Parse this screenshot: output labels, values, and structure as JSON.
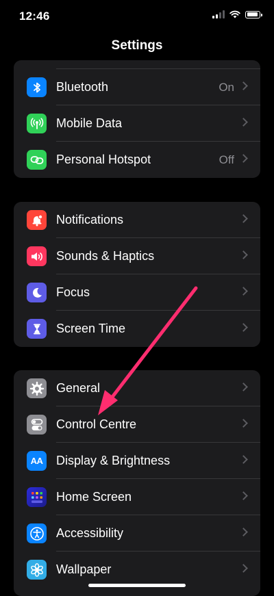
{
  "status": {
    "time": "12:46"
  },
  "nav": {
    "title": "Settings"
  },
  "groups": [
    {
      "rows": [
        {
          "label": "Bluetooth",
          "value": "On",
          "icon": "bluetooth-icon",
          "color": "#0a84ff"
        },
        {
          "label": "Mobile Data",
          "value": "",
          "icon": "antenna-icon",
          "color": "#30d158"
        },
        {
          "label": "Personal Hotspot",
          "value": "Off",
          "icon": "hotspot-link-icon",
          "color": "#30d158"
        }
      ]
    },
    {
      "rows": [
        {
          "label": "Notifications",
          "value": "",
          "icon": "bell-icon",
          "color": "#ff453a"
        },
        {
          "label": "Sounds & Haptics",
          "value": "",
          "icon": "speaker-icon",
          "color": "#ff375f"
        },
        {
          "label": "Focus",
          "value": "",
          "icon": "moon-icon",
          "color": "#5e5ce6"
        },
        {
          "label": "Screen Time",
          "value": "",
          "icon": "hourglass-icon",
          "color": "#5e5ce6"
        }
      ]
    },
    {
      "rows": [
        {
          "label": "General",
          "value": "",
          "icon": "gear-icon",
          "color": "#8e8e93"
        },
        {
          "label": "Control Centre",
          "value": "",
          "icon": "toggles-icon",
          "color": "#8e8e93"
        },
        {
          "label": "Display & Brightness",
          "icon_text": "AA",
          "value": "",
          "icon": "text-size-icon",
          "color": "#0a84ff"
        },
        {
          "label": "Home Screen",
          "value": "",
          "icon": "home-grid-icon",
          "color": "#3a3adf"
        },
        {
          "label": "Accessibility",
          "value": "",
          "icon": "accessibility-icon",
          "color": "#0a84ff"
        },
        {
          "label": "Wallpaper",
          "value": "",
          "icon": "flower-icon",
          "color": "#32ade6"
        }
      ]
    }
  ],
  "annotation": {
    "arrow_color": "#ff2d6f"
  }
}
